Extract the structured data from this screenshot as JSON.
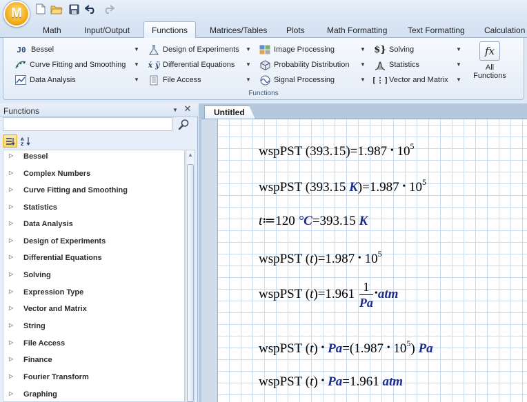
{
  "app": {
    "logo_letter": "M",
    "icons": [
      "new-file-icon",
      "open-folder-icon",
      "save-icon",
      "undo-icon",
      "redo-icon"
    ]
  },
  "tabs": [
    "Math",
    "Input/Output",
    "Functions",
    "Matrices/Tables",
    "Plots",
    "Math Formatting",
    "Text Formatting",
    "Calculation"
  ],
  "active_tab": "Functions",
  "ribbon": {
    "col1": [
      {
        "label": "Bessel",
        "icon": "J0"
      },
      {
        "label": "Curve Fitting and Smoothing",
        "icon": "curve-icon"
      },
      {
        "label": "Data Analysis",
        "icon": "data-analysis-icon"
      }
    ],
    "col2": [
      {
        "label": "Design of Experiments",
        "icon": "flask-icon"
      },
      {
        "label": "Differential Equations",
        "icon": "derivative-icon"
      },
      {
        "label": "File Access",
        "icon": "file-access-icon"
      }
    ],
    "col3": [
      {
        "label": "Image Processing",
        "icon": "image-icon"
      },
      {
        "label": "Probability Distribution",
        "icon": "probability-icon"
      },
      {
        "label": "Signal Processing",
        "icon": "signal-icon"
      }
    ],
    "col4": [
      {
        "label": "Solving",
        "icon": "solving-icon"
      },
      {
        "label": "Statistics",
        "icon": "statistics-icon"
      },
      {
        "label": "Vector and Matrix",
        "icon": "matrix-icon"
      }
    ],
    "group_label": "Functions",
    "all_functions": {
      "symbol": "fx",
      "line1": "All",
      "line2": "Functions"
    }
  },
  "panel": {
    "title": "Functions",
    "search_value": "",
    "items": [
      "Bessel",
      "Complex Numbers",
      "Curve Fitting and Smoothing",
      "Statistics",
      "Data Analysis",
      "Design of Experiments",
      "Differential Equations",
      "Solving",
      "Expression Type",
      "Vector and Matrix",
      "String",
      "File Access",
      "Finance",
      "Fourier Transform",
      "Graphing"
    ]
  },
  "document": {
    "tab_title": "Untitled",
    "eq1": {
      "fn": "wspPST",
      "arg": "393.15",
      "result": "1.987",
      "base": "10",
      "exp": "5"
    },
    "eq2": {
      "fn": "wspPST",
      "arg": "393.15",
      "arg_unit": "K",
      "result": "1.987",
      "base": "10",
      "exp": "5"
    },
    "eq3": {
      "var": "t",
      "def": "≔",
      "value": "120",
      "unit": "°C",
      "result": "393.15",
      "result_unit": "K"
    },
    "eq4": {
      "fn": "wspPST",
      "arg": "t",
      "result": "1.987",
      "base": "10",
      "exp": "5"
    },
    "eq5": {
      "fn": "wspPST",
      "arg": "t",
      "result": "1.961",
      "frac_num": "1",
      "frac_den": "Pa",
      "unit": "atm"
    },
    "eq6": {
      "fn": "wspPST",
      "arg": "t",
      "mult_unit": "Pa",
      "result": "1.987",
      "base": "10",
      "exp": "5",
      "result_unit": "Pa"
    },
    "eq7": {
      "fn": "wspPST",
      "arg": "t",
      "mult_unit": "Pa",
      "result": "1.961",
      "result_unit": "atm"
    }
  }
}
